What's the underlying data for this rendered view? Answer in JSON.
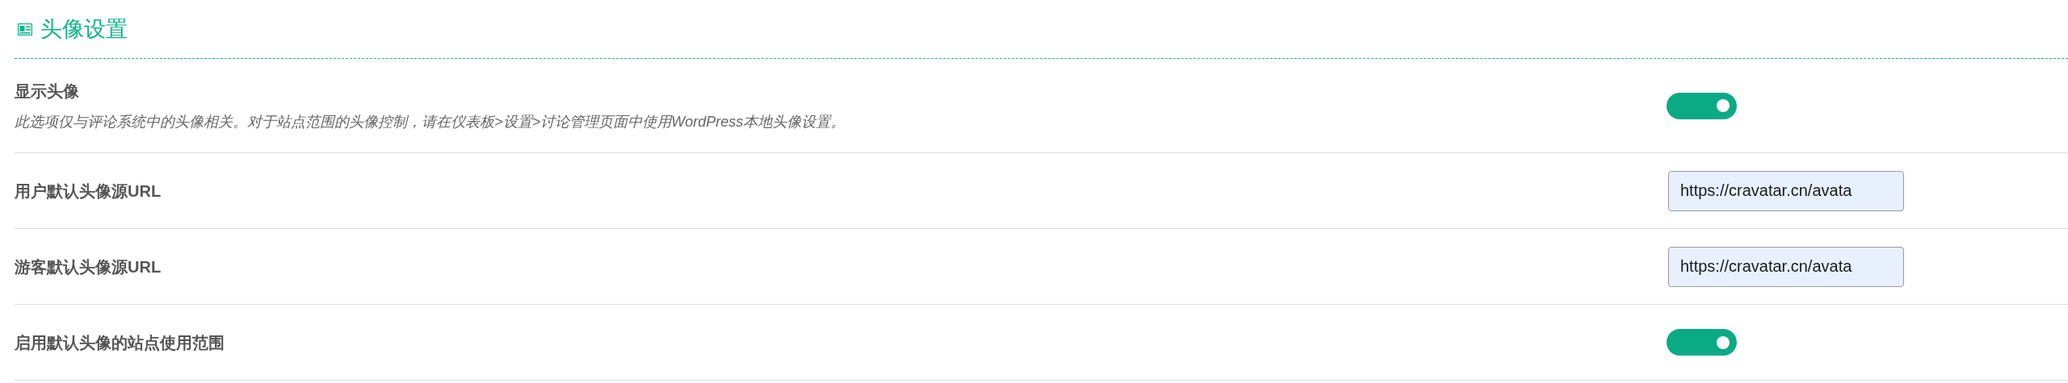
{
  "section": {
    "title": "头像设置"
  },
  "settings": [
    {
      "kind": "toggle",
      "label": "显示头像",
      "description": "此选项仅与评论系统中的头像相关。对于站点范围的头像控制，请在仪表板>设置>讨论管理页面中使用WordPress本地头像设置。",
      "on": true
    },
    {
      "kind": "text",
      "label": "用户默认头像源URL",
      "value": "https://cravatar.cn/avata"
    },
    {
      "kind": "text",
      "label": "游客默认头像源URL",
      "value": "https://cravatar.cn/avata"
    },
    {
      "kind": "toggle",
      "label": "启用默认头像的站点使用范围",
      "on": true
    }
  ]
}
